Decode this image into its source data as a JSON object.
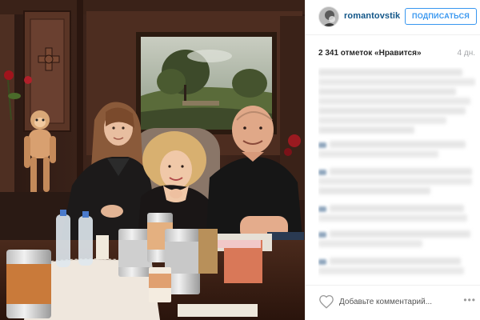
{
  "post": {
    "photo_alt": "",
    "author": {
      "username": "romantovstik"
    },
    "follow_label": "ПОДПИСАТЬСЯ",
    "likes_text": "2 341 отметок «Нравится»",
    "age_text": "4 дн.",
    "comment_placeholder": "Добавьте комментарий...",
    "more_label": "•••"
  },
  "icons": {
    "heart": "heart-icon",
    "more": "ellipsis-icon",
    "avatar": "avatar-image"
  },
  "colors": {
    "accent": "#3897f0",
    "username": "#125688",
    "muted": "#a5a7aa",
    "border": "#efefef"
  }
}
